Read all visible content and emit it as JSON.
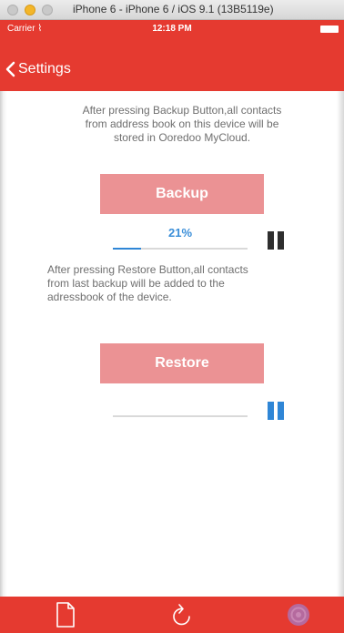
{
  "simulator": {
    "title": "iPhone 6 - iPhone 6 / iOS 9.1 (13B5119e)"
  },
  "status_bar": {
    "carrier": "Carrier ⌇",
    "time": "12:18 PM"
  },
  "nav": {
    "back_label": "Settings"
  },
  "backup": {
    "description": "After pressing Backup Button,all contacts\nfrom address book on this device will be\nstored in Ooredoo MyCloud.",
    "button_label": "Backup",
    "progress_text": "21%",
    "progress": 0.21
  },
  "restore": {
    "description": "After pressing Restore Button,all contacts\nfrom last backup will be added to the\nadressbook of the device.",
    "button_label": "Restore",
    "progress": 0
  },
  "tab_bar": {
    "items": [
      {
        "icon": "document-icon"
      },
      {
        "icon": "refresh-icon"
      },
      {
        "icon": "settings-icon"
      }
    ]
  },
  "colors": {
    "brand_red": "#e53a30",
    "button_pink": "#eb9294",
    "progress_blue": "#2f86d6"
  }
}
